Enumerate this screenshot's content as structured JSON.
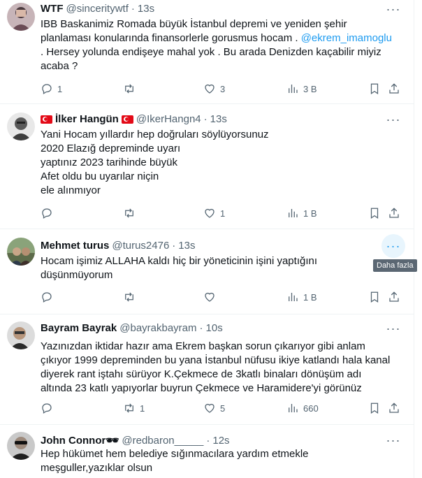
{
  "tweets": [
    {
      "name": "WTF",
      "handle": "@sinceritywtf",
      "time": "13s",
      "lines": [
        "IBB  Baskanimiz Romada büyük İstanbul depremi ve yeniden şehir",
        "planlaması  konularında finansorlerle gorusmus hocam . ",
        ". Hersey yolunda endişeye mahal  yok . Bu arada Denizden kaçabilir miyiz",
        "acaba ?"
      ],
      "mention": "@ekrem_imamoglu",
      "replies": "1",
      "retweets": "",
      "likes": "3",
      "views": "3 B"
    },
    {
      "name": "İlker Hangün",
      "handle": "@IkerHangn4",
      "time": "13s",
      "lines": [
        "Yani Hocam yıllardır hep doğruları söylüyorsunuz",
        "2020 Elazığ depreminde uyarı",
        "yaptınız 2023 tarihinde büyük",
        "Afet oldu bu uyarılar niçin",
        "ele alınmıyor"
      ],
      "replies": "",
      "retweets": "",
      "likes": "1",
      "views": "1 B"
    },
    {
      "name": "Mehmet turus",
      "handle": "@turus2476",
      "time": "13s",
      "lines": [
        "Hocam işimiz ALLAHA kaldı hiç bir yöneticinin işini yaptığını",
        "düşünmüyorum"
      ],
      "replies": "",
      "retweets": "",
      "likes": "",
      "views": "1 B",
      "tooltip": "Daha fazla"
    },
    {
      "name": "Bayram Bayrak",
      "handle": "@bayrakbayram",
      "time": "10s",
      "lines": [
        "Yazınızdan iktidar hazır ama Ekrem başkan sorun çıkarıyor gibi anlam",
        "çıkıyor 1999 depreminden bu yana İstanbul nüfusu ikiye katlandı hala kanal",
        "diyerek rant iştahı sürüyor K.Çekmece de 3katlı binaları dönüşüm adı",
        "altında 23 katlı yapıyorlar buyrun Çekmece ve Haramidere'yi görünüz"
      ],
      "replies": "",
      "retweets": "1",
      "likes": "5",
      "views": "660"
    },
    {
      "name": "John Connor🕶",
      "handle": "@redbaron_____",
      "time": "12s",
      "lines": [
        "Hep hükümet hem belediye sığınmacılara yardım etmekle",
        "meşguller,yazıklar olsun"
      ]
    }
  ]
}
